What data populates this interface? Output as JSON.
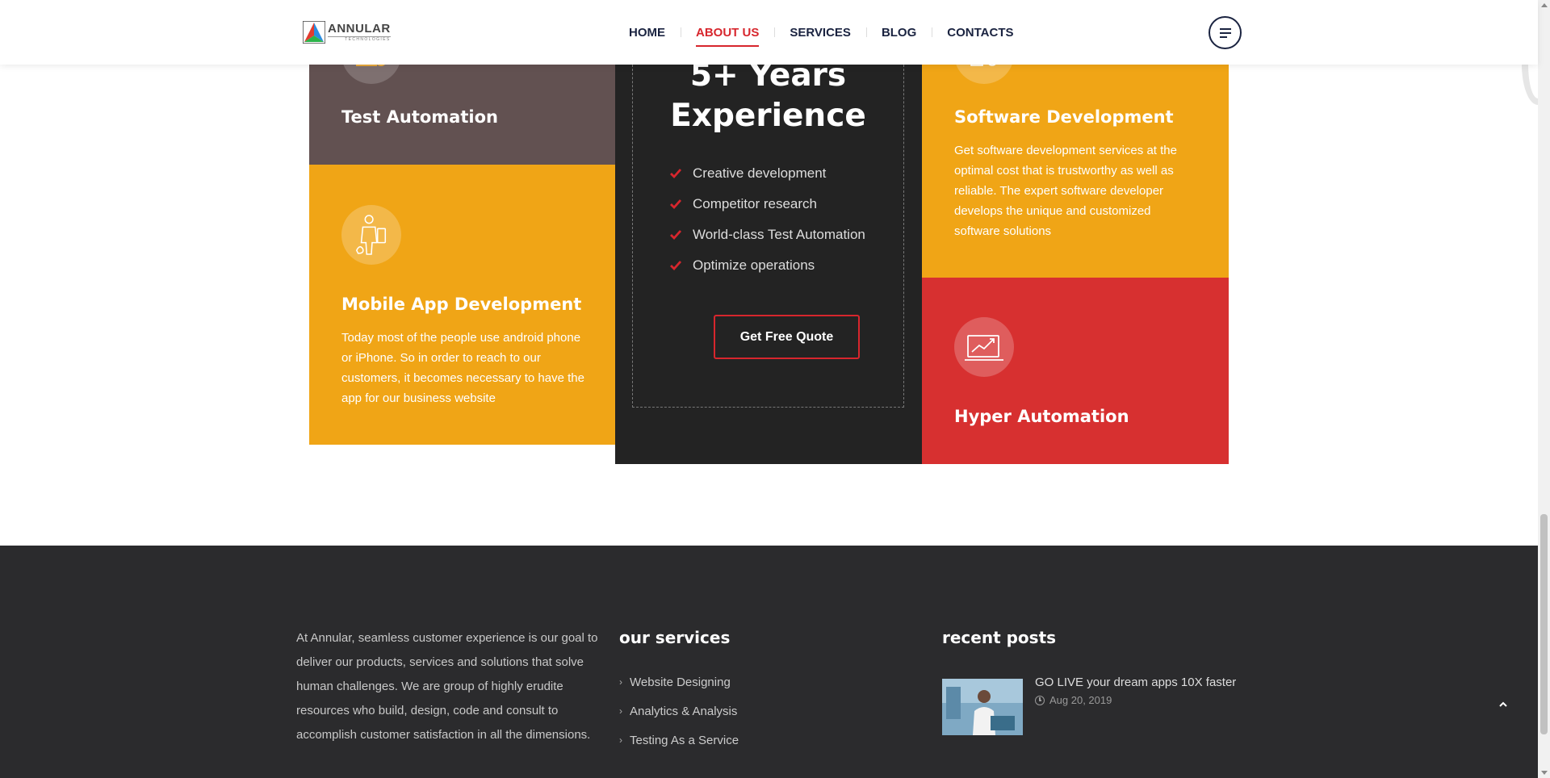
{
  "header": {
    "logo_name": "ANNULAR",
    "logo_sub": "TECHNOLOGIES",
    "nav": [
      {
        "label": "HOME"
      },
      {
        "label": "ABOUT US"
      },
      {
        "label": "SERVICES"
      },
      {
        "label": "BLOG"
      },
      {
        "label": "CONTACTS"
      }
    ],
    "active_nav": "ABOUT US"
  },
  "services": {
    "test_automation": {
      "title": "Test Automation",
      "icon": "automation-gear-icon"
    },
    "mobile_app": {
      "title": "Mobile App Development",
      "icon": "mobile-developer-icon",
      "description": "Today most of the people use android phone or iPhone. So in order to reach to our customers, it becomes necessary to have the app for our business website"
    },
    "software": {
      "title": "Software Development",
      "icon": "software-dev-icon",
      "description": "Get software development services at the optimal cost that is trustworthy as well as reliable. The expert software developer develops the unique and customized software solutions"
    },
    "hyper": {
      "title": "Hyper Automation",
      "icon": "trend-chart-icon"
    }
  },
  "experience": {
    "line1": "5+ Years",
    "line2": "Experience",
    "items": [
      "Creative development",
      "Competitor research",
      "World-class Test Automation",
      "Optimize operations"
    ],
    "cta": "Get Free Quote"
  },
  "footer": {
    "about": "At Annular, seamless customer experience is our goal to deliver our products, services and solutions that solve human challenges. We are group of highly erudite resources who build, design, code and consult to accomplish customer satisfaction in all the dimensions.",
    "services_title": "our services",
    "services": [
      "Website Designing",
      "Analytics & Analysis",
      "Testing As a Service"
    ],
    "posts_title": "recent posts",
    "post": {
      "title": "GO LIVE your dream apps 10X faster",
      "date": "Aug 20, 2019"
    }
  },
  "colors": {
    "accent_red": "#d7262d",
    "orange": "#f0a516",
    "brown": "#625151",
    "dark": "#232323",
    "footer": "#2b2b2d"
  }
}
